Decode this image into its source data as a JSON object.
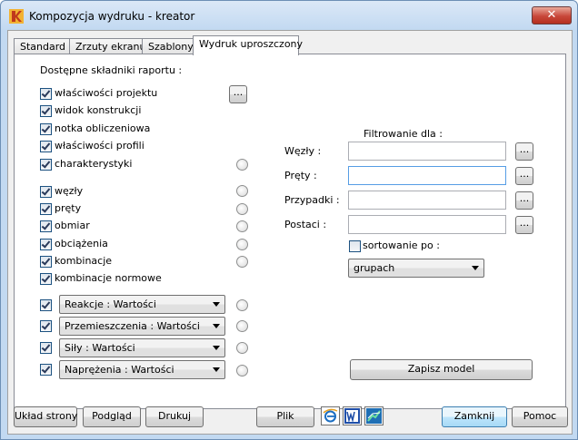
{
  "window": {
    "title": "Kompozycja wydruku - kreator",
    "close_glyph": "✕"
  },
  "tabs": [
    {
      "label": "Standard"
    },
    {
      "label": "Zrzuty ekranu"
    },
    {
      "label": "Szablony"
    },
    {
      "label": "Wydruk uproszczony"
    }
  ],
  "components": {
    "heading": "Dostępne składniki raportu :",
    "items": [
      {
        "label": "właściwości projektu",
        "checked": true
      },
      {
        "label": "widok konstrukcji",
        "checked": true
      },
      {
        "label": "notka obliczeniowa",
        "checked": true
      },
      {
        "label": "właściwości profili",
        "checked": true
      },
      {
        "label": "charakterystyki",
        "checked": true
      },
      {
        "label": "węzły",
        "checked": true
      },
      {
        "label": "pręty",
        "checked": true
      },
      {
        "label": "obmiar",
        "checked": true
      },
      {
        "label": "obciążenia",
        "checked": true
      },
      {
        "label": "kombinacje",
        "checked": true
      },
      {
        "label": "kombinacje normowe",
        "checked": true
      }
    ],
    "ellipsis": "...",
    "tables": [
      {
        "value": "Reakcje : Wartości",
        "checked": true
      },
      {
        "value": "Przemieszczenia : Wartości",
        "checked": true
      },
      {
        "value": "Siły : Wartości",
        "checked": true
      },
      {
        "value": "Naprężenia : Wartości",
        "checked": true
      }
    ]
  },
  "filter": {
    "heading": "Filtrowanie dla :",
    "rows": [
      {
        "label": "Węzły :",
        "value": ""
      },
      {
        "label": "Pręty :",
        "value": ""
      },
      {
        "label": "Przypadki :",
        "value": ""
      },
      {
        "label": "Postaci :",
        "value": ""
      }
    ],
    "ellipsis": "...",
    "sort_label": "sortowanie po :",
    "sort_checked": false,
    "sort_value": "grupach",
    "save_model": "Zapisz model"
  },
  "bottom": {
    "page_layout": "Układ strony",
    "preview": "Podgląd",
    "print": "Drukuj",
    "file": "Plik",
    "close": "Zamknij",
    "help": "Pomoc"
  },
  "colors": {
    "accent": "#3c7fb1",
    "title_bar": "#c2d9f1",
    "close_button": "#c8473a"
  }
}
